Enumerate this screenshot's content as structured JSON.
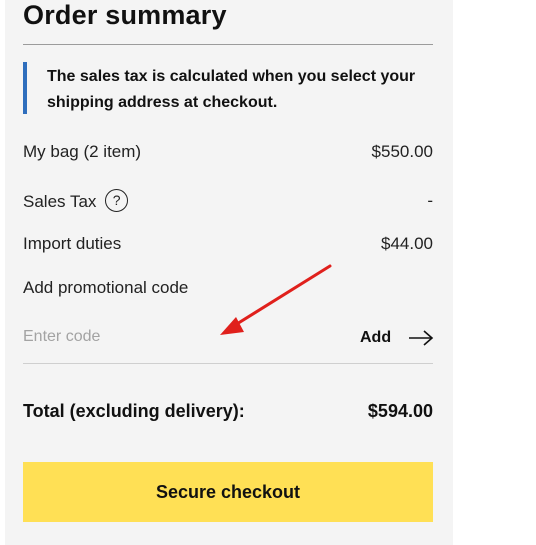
{
  "summary": {
    "title": "Order summary",
    "notice": "The sales tax is calculated when you select your shipping address at checkout."
  },
  "rows": [
    {
      "label": "My bag (2 item)",
      "value": "$550.00"
    },
    {
      "label": "Sales Tax",
      "value": "-"
    },
    {
      "label": "Import duties",
      "value": "$44.00"
    }
  ],
  "help_icon_glyph": "?",
  "promo": {
    "label": "Add promotional code",
    "placeholder": "Enter code",
    "add_label": "Add"
  },
  "total": {
    "label": "Total (excluding delivery):",
    "value": "$594.00"
  },
  "checkout": {
    "label": "Secure checkout"
  },
  "colors": {
    "panel_bg": "#f4f4f4",
    "notice_accent": "#2f6ebd",
    "checkout_bg": "#ffe055",
    "annotation_arrow": "#e0201c"
  },
  "icons": {
    "help": "question-circle-icon",
    "add_arrow": "arrow-right-icon",
    "annotation": "annotation-arrow-icon"
  }
}
